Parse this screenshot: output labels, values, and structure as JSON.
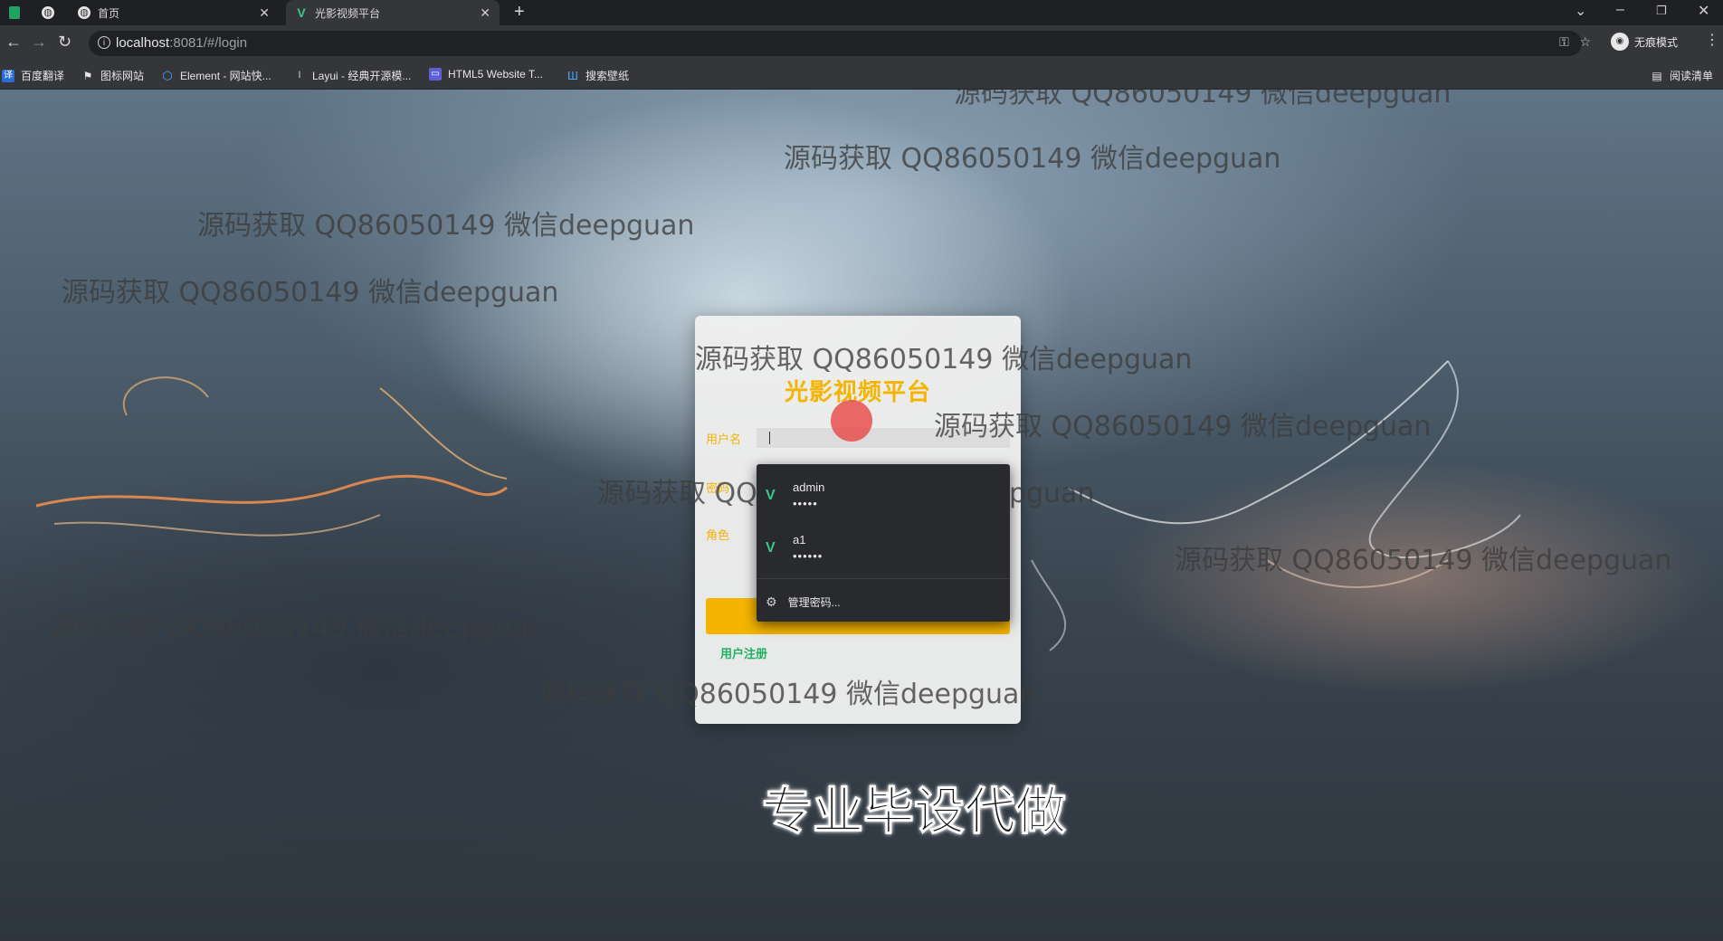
{
  "browser": {
    "tabs": [
      {
        "title": "首页",
        "favicon": "globe-icon"
      },
      {
        "title": "光影视频平台",
        "favicon": "vue-icon",
        "active": true
      }
    ],
    "url_host": "localhost",
    "url_rest": ":8081/#/login",
    "incognito_label": "无痕模式",
    "reading_list_label": "阅读清单",
    "bookmarks": [
      "百度翻译",
      "图标网站",
      "Element - 网站快...",
      "Layui - 经典开源模...",
      "HTML5 Website T...",
      "搜索壁纸"
    ]
  },
  "login": {
    "title": "光影视频平台",
    "username_label": "用户名",
    "password_label": "密码",
    "role_label": "角色",
    "register_label": "用户注册"
  },
  "autofill": {
    "items": [
      {
        "username": "admin",
        "password_mask": "•••••"
      },
      {
        "username": "a1",
        "password_mask": "••••••"
      }
    ],
    "manage_label": "管理密码..."
  },
  "overlay": {
    "watermark": "源码获取 QQ86050149 微信deepguan",
    "caption": "专业毕设代做"
  },
  "colors": {
    "accent": "#f4b400",
    "register": "#20b060",
    "vue_green": "#38c98a"
  }
}
